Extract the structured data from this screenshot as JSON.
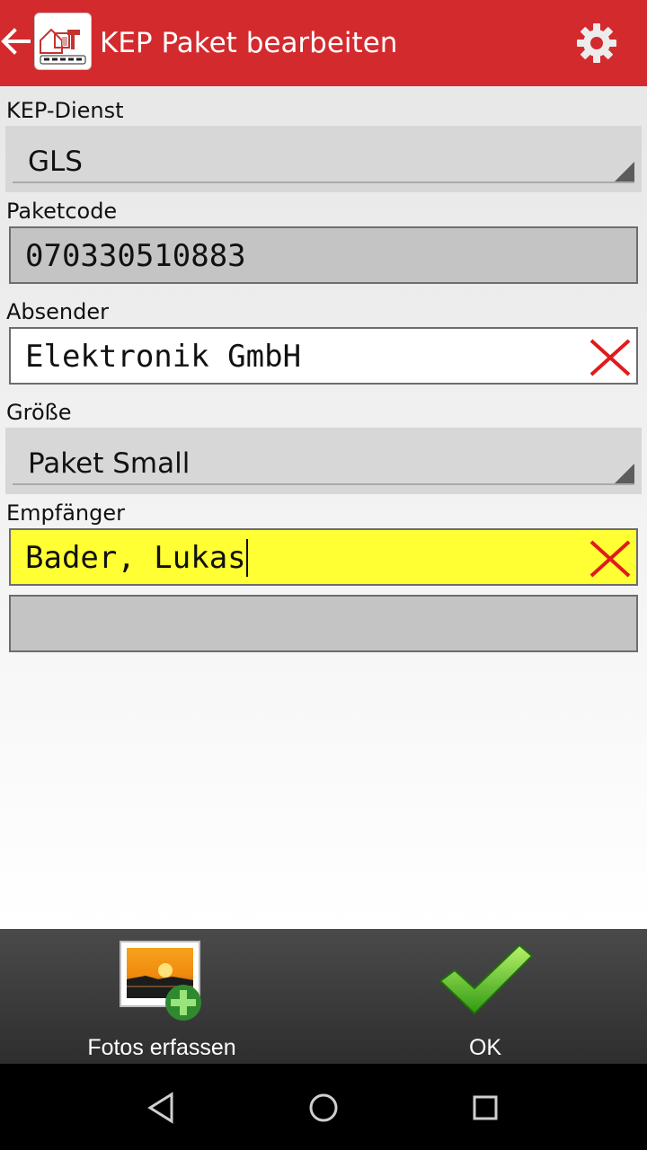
{
  "appbar": {
    "title": "KEP Paket bearbeiten",
    "back_icon": "arrow-back-icon",
    "logo_icon": "app-logo-icon",
    "settings_icon": "gear-icon",
    "background": "#d32a2e"
  },
  "form": {
    "kep_dienst": {
      "label": "KEP-Dienst",
      "value": "GLS"
    },
    "paketcode": {
      "label": "Paketcode",
      "value": "070330510883"
    },
    "absender": {
      "label": "Absender",
      "value": "Elektronik GmbH"
    },
    "groesse": {
      "label": "Größe",
      "value": "Paket Small"
    },
    "empfaenger": {
      "label": "Empfänger",
      "value": "Bader, Lukas",
      "highlight": "#ffff33"
    },
    "extra_field": {
      "value": ""
    }
  },
  "actions": {
    "photos": {
      "label": "Fotos erfassen",
      "icon": "add-photo-icon"
    },
    "ok": {
      "label": "OK",
      "icon": "checkmark-icon"
    }
  },
  "navbar": {
    "back_icon": "nav-back-icon",
    "home_icon": "nav-home-icon",
    "recents_icon": "nav-recents-icon"
  }
}
